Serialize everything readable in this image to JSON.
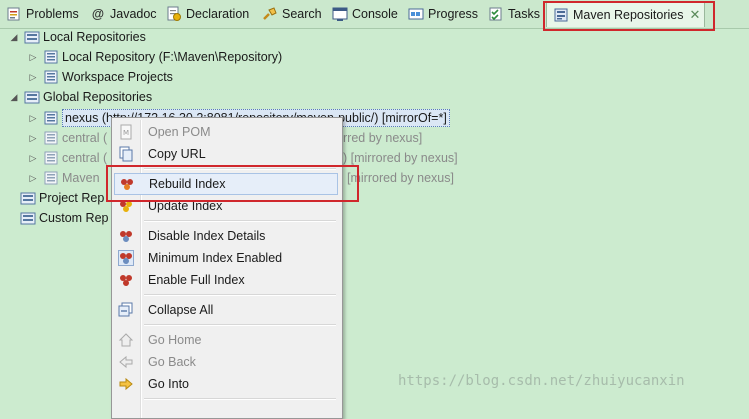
{
  "tabs": [
    {
      "label": "Problems",
      "icon": "problems-icon"
    },
    {
      "label": "Javadoc",
      "icon": "javadoc-icon",
      "glyph": "@"
    },
    {
      "label": "Declaration",
      "icon": "declaration-icon"
    },
    {
      "label": "Search",
      "icon": "search-icon"
    },
    {
      "label": "Console",
      "icon": "console-icon"
    },
    {
      "label": "Progress",
      "icon": "progress-icon"
    },
    {
      "label": "Tasks",
      "icon": "tasks-icon"
    },
    {
      "label": "Maven Repositories",
      "icon": "maven-repositories-icon",
      "close": "✕"
    }
  ],
  "tree": {
    "local": {
      "label": "Local Repositories",
      "children": [
        "Local Repository (F:\\Maven\\Repository)",
        "Workspace Projects"
      ]
    },
    "global": {
      "label": "Global Repositories",
      "children": [
        {
          "prefix": "nexus (",
          "hidden": "http://172.16.30.2:8081/repository/maven-public/)",
          "suffix": "[mirrorOf=*]",
          "selected": true
        },
        {
          "prefix": "central (",
          "suffix": "rred by nexus]"
        },
        {
          "prefix": "central (",
          "suffix": ") [mirrored by nexus]"
        },
        {
          "prefix": "Maven",
          "suffix": "[mirrored by nexus]"
        }
      ]
    },
    "project": {
      "label": "Project Rep"
    },
    "custom": {
      "label": "Custom Rep"
    }
  },
  "menu": {
    "items": {
      "open_pom": "Open POM",
      "copy_url": "Copy URL",
      "rebuild_index": "Rebuild Index",
      "update_index": "Update Index",
      "disable_index_details": "Disable Index Details",
      "minimum_index_enabled": "Minimum Index Enabled",
      "enable_full_index": "Enable Full Index",
      "collapse_all": "Collapse All",
      "go_home": "Go Home",
      "go_back": "Go Back",
      "go_into": "Go Into"
    }
  },
  "watermark": "https://blog.csdn.net/zhuiyucanxin",
  "colors": {
    "background": "#ccebcf",
    "highlight_box": "#d0272c",
    "selection": "#dbe7f5"
  }
}
